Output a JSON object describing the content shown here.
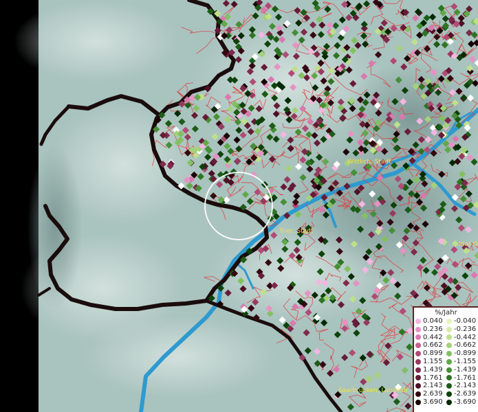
{
  "map": {
    "cities": [
      {
        "id": "wittlich",
        "label": "Wittlich, Stadt"
      },
      {
        "id": "trier",
        "label": "Trier, Stadt"
      },
      {
        "id": "idar",
        "label": "Idar-O"
      },
      {
        "id": "saarbruecken",
        "label": "Saarbrücken, Landesh"
      }
    ],
    "colors": {
      "terrain": "#a9c3bf",
      "admin_lines": "#e0373a",
      "state_border": "#1a0c0c",
      "rivers": "#2e9ad0",
      "highlight_circle": "#ffffff"
    }
  },
  "legend": {
    "title": "%/Jahr",
    "rows": [
      {
        "pos": "0.040",
        "pos_color": "#f3b6e0",
        "neg": "-0.040",
        "neg_color": "#e8f5c0"
      },
      {
        "pos": "0.236",
        "pos_color": "#e692c4",
        "neg": "-0.236",
        "neg_color": "#d6ecaa"
      },
      {
        "pos": "0.442",
        "pos_color": "#d979ae",
        "neg": "-0.442",
        "neg_color": "#bfe08a"
      },
      {
        "pos": "0.662",
        "pos_color": "#c7618f",
        "neg": "-0.662",
        "neg_color": "#a4d27a"
      },
      {
        "pos": "0.899",
        "pos_color": "#b04c76",
        "neg": "-0.899",
        "neg_color": "#84c063"
      },
      {
        "pos": "1.155",
        "pos_color": "#983a60",
        "neg": "-1.155",
        "neg_color": "#62a84a"
      },
      {
        "pos": "1.439",
        "pos_color": "#7f2a4a",
        "neg": "-1.439",
        "neg_color": "#478f37"
      },
      {
        "pos": "1.761",
        "pos_color": "#661c36",
        "neg": "-1.761",
        "neg_color": "#2f7525"
      },
      {
        "pos": "2.143",
        "pos_color": "#4d1024",
        "neg": "-2.143",
        "neg_color": "#1c5c17"
      },
      {
        "pos": "2.639",
        "pos_color": "#330812",
        "neg": "-2.639",
        "neg_color": "#0e420b"
      },
      {
        "pos": "3.690",
        "pos_color": "#1a0306",
        "neg": "-3.690",
        "neg_color": "#042a03"
      }
    ]
  }
}
